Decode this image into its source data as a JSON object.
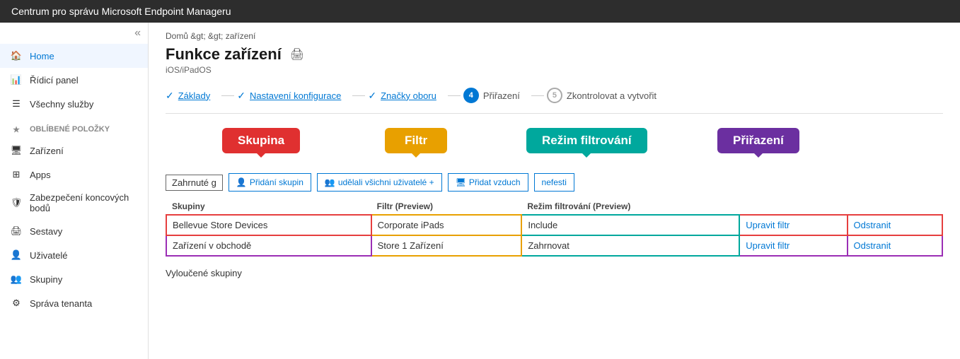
{
  "topbar": {
    "title": "Centrum pro správu Microsoft Endpoint Manageru"
  },
  "sidebar": {
    "collapse_icon": "«",
    "items": [
      {
        "id": "home",
        "label": "Home",
        "icon": "🏠",
        "active": false
      },
      {
        "id": "dashboard",
        "label": "Řídicí panel",
        "icon": "📊",
        "active": false
      },
      {
        "id": "all-services",
        "label": "Všechny služby",
        "icon": "☰",
        "active": false
      },
      {
        "id": "favorites-label",
        "label": "OBLÍBENÉ POLOŽKY",
        "icon": "★",
        "section": true
      },
      {
        "id": "devices",
        "label": "Zařízení",
        "icon": "🖥",
        "active": false
      },
      {
        "id": "apps",
        "label": "Apps",
        "icon": "⊞",
        "active": false
      },
      {
        "id": "endpoint-security",
        "label": "Zabezpečení koncových bodů",
        "icon": "🛡",
        "active": false
      },
      {
        "id": "reports",
        "label": "Sestavy",
        "icon": "🖨",
        "active": false
      },
      {
        "id": "users",
        "label": "Uživatelé",
        "icon": "👤",
        "active": false
      },
      {
        "id": "groups",
        "label": "Skupiny",
        "icon": "👥",
        "active": false
      },
      {
        "id": "tenant",
        "label": "Správa tenanta",
        "icon": "⚙",
        "active": false
      }
    ]
  },
  "breadcrumb": "Domů &gt; &gt; zařízení",
  "page": {
    "title": "Funkce zařízení",
    "subtitle": "iOS/iPadOS",
    "print_icon": "🖨"
  },
  "wizard": {
    "steps": [
      {
        "id": "basics",
        "label": "Základy",
        "completed": true,
        "active": false
      },
      {
        "id": "config",
        "label": "Nastavení konfigurace",
        "completed": true,
        "active": false
      },
      {
        "id": "scope",
        "label": "Značky oboru",
        "completed": true,
        "active": false
      },
      {
        "id": "assign",
        "label": "Přiřazení",
        "number": "4",
        "completed": false,
        "active": true
      },
      {
        "id": "review",
        "label": "Zkontrolovat a vytvořit",
        "number": "5",
        "completed": false,
        "active": false
      }
    ]
  },
  "assignment": {
    "included_groups_label": "Zahrnuté g",
    "buttons": [
      {
        "id": "add-groups",
        "label": "Přidání skupin",
        "icon": "👤"
      },
      {
        "id": "add-all-users",
        "label": "udělali všichni uživatelé +",
        "icon": "👥"
      },
      {
        "id": "add-devices",
        "label": "Přidat vzduch",
        "icon": "🖥"
      },
      {
        "id": "nefesti",
        "label": "nefesti",
        "icon": ""
      }
    ],
    "table_headers": [
      "Skupiny",
      "Filtr (Preview)",
      "Režim filtrování (Preview)",
      "",
      ""
    ],
    "rows": [
      {
        "group": "Bellevue Store Devices",
        "filter": "Corporate iPads",
        "filter_mode": "Include",
        "edit_label": "Upravit filtr",
        "delete_label": "Odstranit",
        "row_class": "row1"
      },
      {
        "group": "Zařízení v obchodě",
        "filter": "Store 1  Zařízení",
        "filter_mode": "Zahrnovat",
        "edit_label": "Upravit filtr",
        "delete_label": "Odstranit",
        "row_class": "row2"
      }
    ],
    "excluded_section_label": "Vyloučené skupiny"
  },
  "callouts": [
    {
      "id": "skupina",
      "label": "Skupina",
      "color": "#e03030"
    },
    {
      "id": "filtr",
      "label": "Filtr",
      "color": "#e8a000"
    },
    {
      "id": "rezim",
      "label": "Režim filtrování",
      "color": "#00a89d"
    },
    {
      "id": "prirazeni",
      "label": "Přiřazení",
      "color": "#6b2fa0"
    }
  ]
}
